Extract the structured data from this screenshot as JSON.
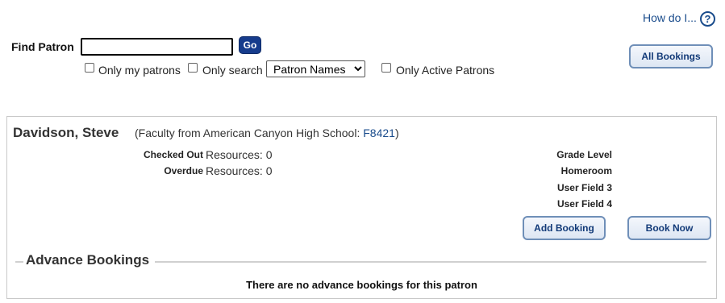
{
  "header": {
    "help_link": "How do I...",
    "help_icon_glyph": "?"
  },
  "find": {
    "label": "Find Patron",
    "input_value": "",
    "go_label": "Go",
    "options": {
      "only_my_patrons": "Only my patrons",
      "only_search": "Only search",
      "search_select_value": "Patron Names",
      "only_active": "Only Active Patrons"
    },
    "all_bookings_label": "All Bookings"
  },
  "patron": {
    "name": "Davidson, Steve",
    "desc_prefix": "(Faculty from American Canyon High School: ",
    "barcode": "F8421",
    "desc_suffix": ")",
    "stats": {
      "checked_key": "Checked Out",
      "checked_rest": "Resources: 0",
      "overdue_key": "Overdue",
      "overdue_rest": "Resources: 0"
    },
    "fields": {
      "grade_level": "Grade Level",
      "homeroom": "Homeroom",
      "user_field_3": "User Field 3",
      "user_field_4": "User Field 4"
    },
    "add_booking_label": "Add Booking",
    "book_now_label": "Book Now"
  },
  "advance": {
    "title": "Advance Bookings",
    "empty_message": "There are no advance bookings for this patron"
  },
  "colors": {
    "link": "#1a4c8c",
    "go_button": "#163c8c",
    "button_border": "#6f8fb8"
  }
}
